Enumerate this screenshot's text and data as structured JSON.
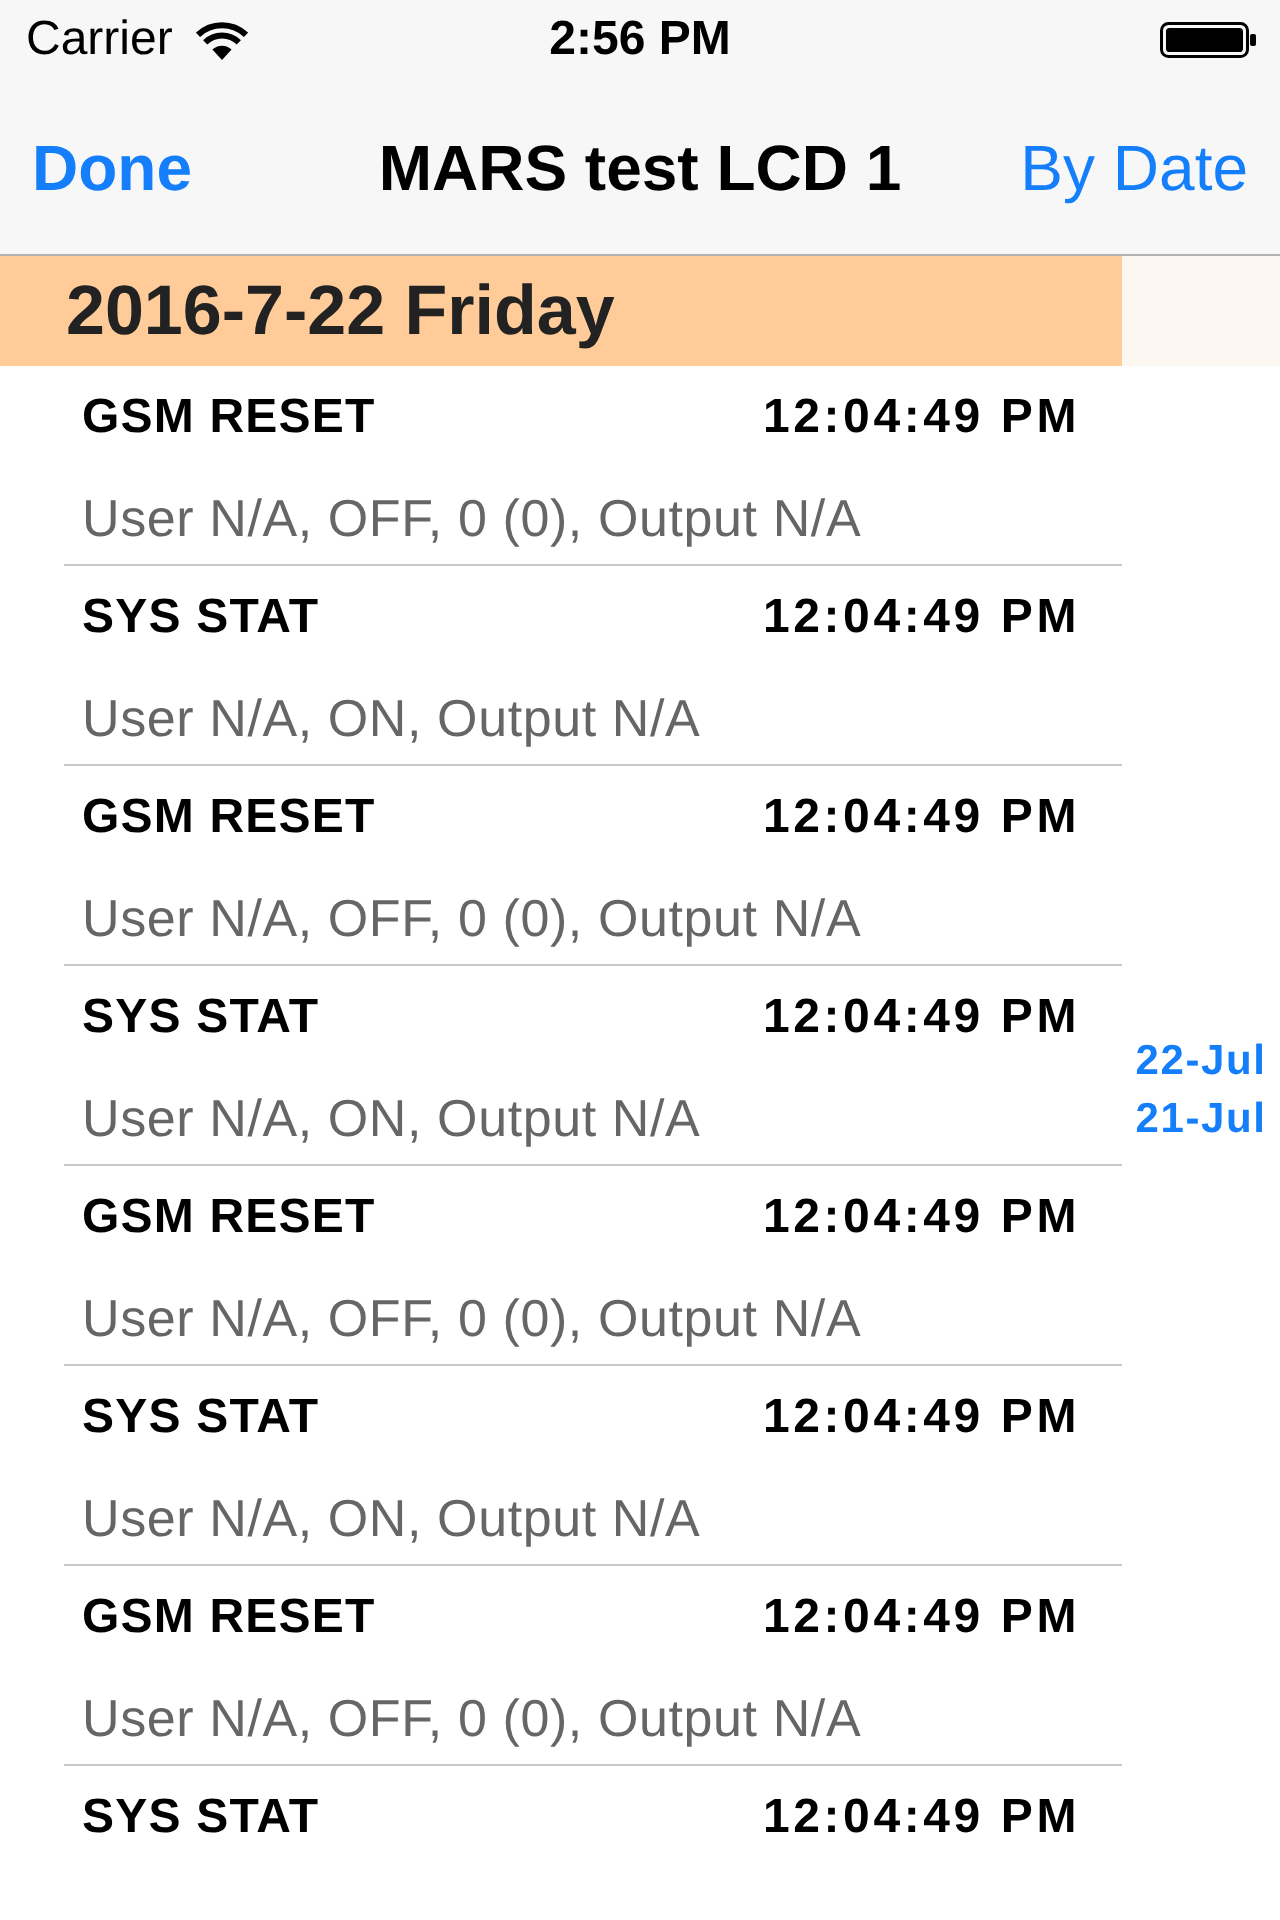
{
  "status_bar": {
    "carrier": "Carrier",
    "time": "2:56 PM"
  },
  "nav_bar": {
    "left_button": "Done",
    "title": "MARS test LCD 1",
    "right_button": "By Date"
  },
  "sections": [
    {
      "header": "2016-7-22 Friday",
      "rows": [
        {
          "event": "GSM RESET",
          "time": "12:04:49 PM",
          "detail": "User N/A, OFF, 0 (0), Output N/A"
        },
        {
          "event": "SYS STAT",
          "time": "12:04:49 PM",
          "detail": "User N/A, ON, Output N/A"
        },
        {
          "event": "GSM RESET",
          "time": "12:04:49 PM",
          "detail": "User N/A, OFF, 0 (0), Output N/A"
        },
        {
          "event": "SYS STAT",
          "time": "12:04:49 PM",
          "detail": "User N/A, ON, Output N/A"
        },
        {
          "event": "GSM RESET",
          "time": "12:04:49 PM",
          "detail": "User N/A, OFF, 0 (0), Output N/A"
        },
        {
          "event": "SYS STAT",
          "time": "12:04:49 PM",
          "detail": "User N/A, ON, Output N/A"
        },
        {
          "event": "GSM RESET",
          "time": "12:04:49 PM",
          "detail": "User N/A, OFF, 0 (0), Output N/A"
        },
        {
          "event": "SYS STAT",
          "time": "12:04:49 PM"
        }
      ]
    }
  ],
  "section_index": [
    "22-Jul",
    "21-Jul"
  ]
}
